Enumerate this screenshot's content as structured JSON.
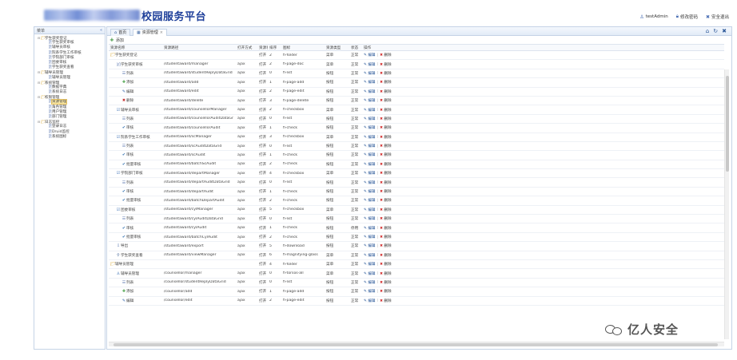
{
  "header": {
    "title": "校园服务平台",
    "user": "testAdmin",
    "change_password": "修改密码",
    "logout": "安全退出"
  },
  "sidebar": {
    "title": "菜单",
    "collapse": "«",
    "items": [
      {
        "label": "学生获奖登记",
        "level": 0,
        "type": "folder"
      },
      {
        "label": "学生获奖审核",
        "level": 1,
        "type": "page"
      },
      {
        "label": "辅导员审核",
        "level": 1,
        "type": "page"
      },
      {
        "label": "院系学生工作审核",
        "level": 1,
        "type": "page"
      },
      {
        "label": "学院部门审核",
        "level": 1,
        "type": "page"
      },
      {
        "label": "团委审核",
        "level": 1,
        "type": "page"
      },
      {
        "label": "学生获奖查看",
        "level": 1,
        "type": "page"
      },
      {
        "label": "辅导员管理",
        "level": 0,
        "type": "folder"
      },
      {
        "label": "辅导员管理",
        "level": 1,
        "type": "page"
      },
      {
        "label": "系统管理",
        "level": 0,
        "type": "folder"
      },
      {
        "label": "数据字典",
        "level": 1,
        "type": "page"
      },
      {
        "label": "系统日志",
        "level": 1,
        "type": "page"
      },
      {
        "label": "权限管理",
        "level": 0,
        "type": "folder"
      },
      {
        "label": "资源管理",
        "level": 1,
        "type": "page",
        "selected": true
      },
      {
        "label": "角色管理",
        "level": 1,
        "type": "page"
      },
      {
        "label": "用户管理",
        "level": 1,
        "type": "page"
      },
      {
        "label": "部门管理",
        "level": 1,
        "type": "page"
      },
      {
        "label": "日志监控",
        "level": 0,
        "type": "folder"
      },
      {
        "label": "登录日志",
        "level": 1,
        "type": "page"
      },
      {
        "label": "Druid监控",
        "level": 1,
        "type": "page"
      },
      {
        "label": "系统图标",
        "level": 1,
        "type": "page"
      }
    ]
  },
  "tabs": [
    {
      "label": "首页",
      "icon": "home-icon"
    },
    {
      "label": "资源管理",
      "icon": "grid-icon",
      "closable": true
    }
  ],
  "toolbar": {
    "add": "添加"
  },
  "grid": {
    "columns": [
      "资源名称",
      "资源路径",
      "打开方式",
      "资源状态",
      "排序",
      "图标",
      "资源类型",
      "状态",
      "操作"
    ],
    "edit_label": "编辑",
    "delete_label": "删除",
    "rows": [
      {
        "name": "学生获奖登记",
        "icon": "folder",
        "indent": 0,
        "path": "",
        "open": "",
        "rstate": "打开",
        "sort": "2",
        "iconcls": "fi-folder",
        "type": "菜单",
        "status": "正常"
      },
      {
        "name": "学生获奖审核",
        "icon": "page",
        "indent": 1,
        "path": "/studentaward/manager",
        "open": "ajax",
        "rstate": "打开",
        "sort": "2",
        "iconcls": "fi-page-doc",
        "type": "菜单",
        "status": "正常"
      },
      {
        "name": "列表",
        "icon": "list",
        "indent": 2,
        "path": "/studentaward/studentReplyDataGrid",
        "open": "ajax",
        "rstate": "打开",
        "sort": "0",
        "iconcls": "fi-list",
        "type": "按钮",
        "status": "正常"
      },
      {
        "name": "添加",
        "icon": "add",
        "indent": 2,
        "path": "/studentaward/add",
        "open": "ajax",
        "rstate": "打开",
        "sort": "1",
        "iconcls": "fi-page-add",
        "type": "按钮",
        "status": "正常"
      },
      {
        "name": "编辑",
        "icon": "edit",
        "indent": 2,
        "path": "/studentaward/edit",
        "open": "ajax",
        "rstate": "打开",
        "sort": "2",
        "iconcls": "fi-page-edit",
        "type": "按钮",
        "status": "正常"
      },
      {
        "name": "删除",
        "icon": "delete",
        "indent": 2,
        "path": "/studentaward/delete",
        "open": "ajax",
        "rstate": "打开",
        "sort": "3",
        "iconcls": "fi-page-delete",
        "type": "按钮",
        "status": "正常"
      },
      {
        "name": "辅导员审核",
        "icon": "check",
        "indent": 1,
        "path": "/studentaward/counsellorManager",
        "open": "ajax",
        "rstate": "打开",
        "sort": "2",
        "iconcls": "fi-checkbox",
        "type": "菜单",
        "status": "正常"
      },
      {
        "name": "列表",
        "icon": "list",
        "indent": 2,
        "path": "/studentaward/counsellorAuditDataGr",
        "open": "ajax",
        "rstate": "打开",
        "sort": "0",
        "iconcls": "fi-list",
        "type": "按钮",
        "status": "正常"
      },
      {
        "name": "审核",
        "icon": "tick",
        "indent": 2,
        "path": "/studentaward/counsellorAudit",
        "open": "ajax",
        "rstate": "打开",
        "sort": "1",
        "iconcls": "fi-check",
        "type": "按钮",
        "status": "正常"
      },
      {
        "name": "院系学生工作审核",
        "icon": "check",
        "indent": 1,
        "path": "/studentaward/scManager",
        "open": "ajax",
        "rstate": "打开",
        "sort": "3",
        "iconcls": "fi-checkbox",
        "type": "菜单",
        "status": "正常"
      },
      {
        "name": "列表",
        "icon": "list",
        "indent": 2,
        "path": "/studentaward/scAuditDataGrid",
        "open": "ajax",
        "rstate": "打开",
        "sort": "0",
        "iconcls": "fi-list",
        "type": "按钮",
        "status": "正常"
      },
      {
        "name": "审核",
        "icon": "tick",
        "indent": 2,
        "path": "/studentaward/scAudit",
        "open": "ajax",
        "rstate": "打开",
        "sort": "1",
        "iconcls": "fi-check",
        "type": "按钮",
        "status": "正常"
      },
      {
        "name": "批量审核",
        "icon": "tick",
        "indent": 2,
        "path": "/studentaward/batchScAudit",
        "open": "ajax",
        "rstate": "打开",
        "sort": "2",
        "iconcls": "fi-check",
        "type": "按钮",
        "status": "正常"
      },
      {
        "name": "学院部门审核",
        "icon": "check",
        "indent": 1,
        "path": "/studentaward/departManager",
        "open": "ajax",
        "rstate": "打开",
        "sort": "4",
        "iconcls": "fi-checkbox",
        "type": "菜单",
        "status": "正常"
      },
      {
        "name": "列表",
        "icon": "list",
        "indent": 2,
        "path": "/studentaward/departAuditDataGrid",
        "open": "ajax",
        "rstate": "打开",
        "sort": "0",
        "iconcls": "fi-list",
        "type": "按钮",
        "status": "正常"
      },
      {
        "name": "审核",
        "icon": "tick",
        "indent": 2,
        "path": "/studentaward/departAudit",
        "open": "ajax",
        "rstate": "打开",
        "sort": "1",
        "iconcls": "fi-check",
        "type": "按钮",
        "status": "正常"
      },
      {
        "name": "批量审核",
        "icon": "tick",
        "indent": 2,
        "path": "/studentaward/batchDepartAudit",
        "open": "ajax",
        "rstate": "打开",
        "sort": "2",
        "iconcls": "fi-check",
        "type": "按钮",
        "status": "正常"
      },
      {
        "name": "团委审核",
        "icon": "check",
        "indent": 1,
        "path": "/studentaward/cylManager",
        "open": "ajax",
        "rstate": "打开",
        "sort": "5",
        "iconcls": "fi-checkbox",
        "type": "菜单",
        "status": "正常"
      },
      {
        "name": "列表",
        "icon": "list",
        "indent": 2,
        "path": "/studentaward/cylAuditDataGrid",
        "open": "ajax",
        "rstate": "打开",
        "sort": "0",
        "iconcls": "fi-list",
        "type": "按钮",
        "status": "正常"
      },
      {
        "name": "审核",
        "icon": "tick",
        "indent": 2,
        "path": "/studentaward/cylAudit",
        "open": "ajax",
        "rstate": "打开",
        "sort": "1",
        "iconcls": "fi-check",
        "type": "按钮",
        "status": "停用"
      },
      {
        "name": "批量审核",
        "icon": "tick",
        "indent": 2,
        "path": "/studentaward/batchCylAudit",
        "open": "ajax",
        "rstate": "打开",
        "sort": "2",
        "iconcls": "fi-check",
        "type": "按钮",
        "status": "正常"
      },
      {
        "name": "导出",
        "icon": "export",
        "indent": 1,
        "path": "/studentaward/export",
        "open": "ajax",
        "rstate": "打开",
        "sort": "5",
        "iconcls": "fi-download",
        "type": "按钮",
        "status": "正常"
      },
      {
        "name": "学生获奖查看",
        "icon": "search",
        "indent": 1,
        "path": "/studentaward/viewManager",
        "open": "ajax",
        "rstate": "打开",
        "sort": "6",
        "iconcls": "fi-magnifying-glass",
        "type": "菜单",
        "status": "正常"
      },
      {
        "name": "辅导员管理",
        "icon": "folder",
        "indent": 0,
        "path": "",
        "open": "",
        "rstate": "打开",
        "sort": "4",
        "iconcls": "fi-folder",
        "type": "菜单",
        "status": "正常"
      },
      {
        "name": "辅导员管理",
        "icon": "users",
        "indent": 1,
        "path": "/counsellor/manager",
        "open": "ajax",
        "rstate": "打开",
        "sort": "0",
        "iconcls": "fi-torsos-all",
        "type": "菜单",
        "status": "正常"
      },
      {
        "name": "列表",
        "icon": "list",
        "indent": 2,
        "path": "/counsellor/studentReplyDataGrid",
        "open": "ajax",
        "rstate": "打开",
        "sort": "0",
        "iconcls": "fi-list",
        "type": "按钮",
        "status": "正常"
      },
      {
        "name": "添加",
        "icon": "add",
        "indent": 2,
        "path": "/counsellor/add",
        "open": "ajax",
        "rstate": "打开",
        "sort": "1",
        "iconcls": "fi-page-add",
        "type": "按钮",
        "status": "正常"
      },
      {
        "name": "编辑",
        "icon": "edit",
        "indent": 2,
        "path": "/counsellor/edit",
        "open": "ajax",
        "rstate": "打开",
        "sort": "2",
        "iconcls": "fi-page-edit",
        "type": "按钮",
        "status": "正常"
      }
    ]
  },
  "watermark": {
    "text": "亿人安全"
  }
}
